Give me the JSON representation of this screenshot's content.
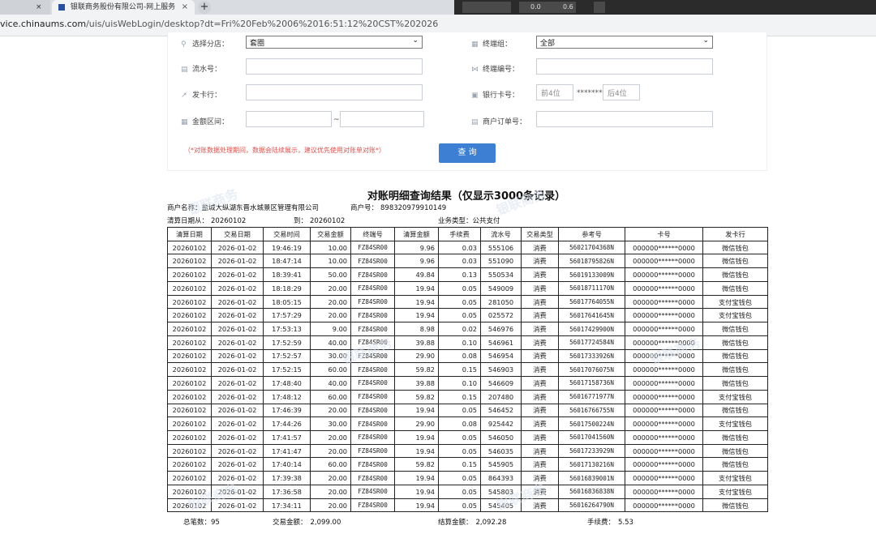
{
  "browser": {
    "tab_prev_close": "×",
    "tab_title": "银联商务股份有限公司-网上服务",
    "tab_close": "×",
    "new_tab": "+",
    "tray_left": "0.0",
    "tray_mid": "0.6",
    "url_prefix": "vice.chinaums.com",
    "url_rest": "/uis/uisWebLogin/desktop?dt=Fri%20Feb%2006%2016:51:12%20CST%202026"
  },
  "form": {
    "branch_label": "选择分店：",
    "branch_value": "套圈",
    "terminal_group_label": "终端组：",
    "terminal_group_value": "全部",
    "serial_label": "流水号：",
    "terminal_no_label": "终端编号：",
    "issuer_label": "发卡行：",
    "bank_card_label": "银行卡号：",
    "card_first4_placeholder": "前4位",
    "card_mask": "********",
    "card_last4_placeholder": "后4位",
    "amount_label": "金额区间：",
    "amount_sep": "~",
    "order_label": "商户订单号：",
    "note": "（*对账数据处理期间，数据会陆续展示，建议优先使用对账单对账*）",
    "query_button": "查 询"
  },
  "result": {
    "title": "对账明细查询结果（仅显示3000条记录）",
    "merchant_name_label": "商户名称：",
    "merchant_name": "盐城大纵湖东晋水城景区管理有限公司",
    "merchant_no_label": "商户号：",
    "merchant_no": "898320979910149",
    "date_from_label": "清算日期从：",
    "date_from": "20260102",
    "date_to_label": "到：",
    "date_to": "20260102",
    "biz_type_label": "业务类型：",
    "biz_type": "公共支付",
    "columns": [
      "清算日期",
      "交易日期",
      "交易时间",
      "交易金额",
      "终端号",
      "清算金额",
      "手续费",
      "流水号",
      "交易类型",
      "参考号",
      "卡号",
      "发卡行"
    ],
    "rows": [
      [
        "20260102",
        "2026-01-02",
        "19:46:19",
        "10.00",
        "FZ84SR00",
        "9.96",
        "0.03",
        "555106",
        "消费",
        "56021704368N",
        "000000******0000",
        "微信钱包"
      ],
      [
        "20260102",
        "2026-01-02",
        "18:47:14",
        "10.00",
        "FZ84SR00",
        "9.96",
        "0.03",
        "551090",
        "消费",
        "56018795826N",
        "000000******0000",
        "微信钱包"
      ],
      [
        "20260102",
        "2026-01-02",
        "18:39:41",
        "50.00",
        "FZ84SR00",
        "49.84",
        "0.13",
        "550534",
        "消费",
        "56019133009N",
        "000000******0000",
        "微信钱包"
      ],
      [
        "20260102",
        "2026-01-02",
        "18:18:29",
        "20.00",
        "FZ84SR00",
        "19.94",
        "0.05",
        "549009",
        "消费",
        "56018711170N",
        "000000******0000",
        "微信钱包"
      ],
      [
        "20260102",
        "2026-01-02",
        "18:05:15",
        "20.00",
        "FZ84SR00",
        "19.94",
        "0.05",
        "281050",
        "消费",
        "56017764055N",
        "000000******0000",
        "支付宝钱包"
      ],
      [
        "20260102",
        "2026-01-02",
        "17:57:29",
        "20.00",
        "FZ84SR00",
        "19.94",
        "0.05",
        "025572",
        "消费",
        "56017641645N",
        "000000******0000",
        "支付宝钱包"
      ],
      [
        "20260102",
        "2026-01-02",
        "17:53:13",
        "9.00",
        "FZ84SR00",
        "8.98",
        "0.02",
        "546976",
        "消费",
        "56017429900N",
        "000000******0000",
        "微信钱包"
      ],
      [
        "20260102",
        "2026-01-02",
        "17:52:59",
        "40.00",
        "FZ84SR00",
        "39.88",
        "0.10",
        "546961",
        "消费",
        "56017724584N",
        "000000******0000",
        "微信钱包"
      ],
      [
        "20260102",
        "2026-01-02",
        "17:52:57",
        "30.00",
        "FZ84SR00",
        "29.90",
        "0.08",
        "546954",
        "消费",
        "56017333926N",
        "000000******0000",
        "微信钱包"
      ],
      [
        "20260102",
        "2026-01-02",
        "17:52:15",
        "60.00",
        "FZ84SR00",
        "59.82",
        "0.15",
        "546903",
        "消费",
        "56017076075N",
        "000000******0000",
        "微信钱包"
      ],
      [
        "20260102",
        "2026-01-02",
        "17:48:40",
        "40.00",
        "FZ84SR00",
        "39.88",
        "0.10",
        "546609",
        "消费",
        "56017158736N",
        "000000******0000",
        "微信钱包"
      ],
      [
        "20260102",
        "2026-01-02",
        "17:48:12",
        "60.00",
        "FZ84SR00",
        "59.82",
        "0.15",
        "207480",
        "消费",
        "56016771977N",
        "000000******0000",
        "支付宝钱包"
      ],
      [
        "20260102",
        "2026-01-02",
        "17:46:39",
        "20.00",
        "FZ84SR00",
        "19.94",
        "0.05",
        "546452",
        "消费",
        "56016766755N",
        "000000******0000",
        "微信钱包"
      ],
      [
        "20260102",
        "2026-01-02",
        "17:44:26",
        "30.00",
        "FZ84SR00",
        "29.90",
        "0.08",
        "925442",
        "消费",
        "56017500224N",
        "000000******0000",
        "支付宝钱包"
      ],
      [
        "20260102",
        "2026-01-02",
        "17:41:57",
        "20.00",
        "FZ84SR00",
        "19.94",
        "0.05",
        "546050",
        "消费",
        "56017041560N",
        "000000******0000",
        "微信钱包"
      ],
      [
        "20260102",
        "2026-01-02",
        "17:41:47",
        "20.00",
        "FZ84SR00",
        "19.94",
        "0.05",
        "546035",
        "消费",
        "56017233929N",
        "000000******0000",
        "微信钱包"
      ],
      [
        "20260102",
        "2026-01-02",
        "17:40:14",
        "60.00",
        "FZ84SR00",
        "59.82",
        "0.15",
        "545905",
        "消费",
        "56017130216N",
        "000000******0000",
        "微信钱包"
      ],
      [
        "20260102",
        "2026-01-02",
        "17:39:38",
        "20.00",
        "FZ84SR00",
        "19.94",
        "0.05",
        "864393",
        "消费",
        "56016839001N",
        "000000******0000",
        "支付宝钱包"
      ],
      [
        "20260102",
        "2026-01-02",
        "17:36:58",
        "20.00",
        "FZ84SR00",
        "19.94",
        "0.05",
        "545803",
        "消费",
        "56016836838N",
        "000000******0000",
        "支付宝钱包"
      ],
      [
        "20260102",
        "2026-01-02",
        "17:34:11",
        "20.00",
        "FZ84SR00",
        "19.94",
        "0.05",
        "545405",
        "消费",
        "56016264790N",
        "000000******0000",
        "微信钱包"
      ]
    ],
    "total_count_label": "总笔数：",
    "total_count": "95",
    "total_amount_label": "交易金额：",
    "total_amount": "2,099.00",
    "settle_amount_label": "结算金额：",
    "settle_amount": "2,092.28",
    "fee_label": "手续费：",
    "fee": "5.53"
  },
  "watermark_text": "银联商务"
}
